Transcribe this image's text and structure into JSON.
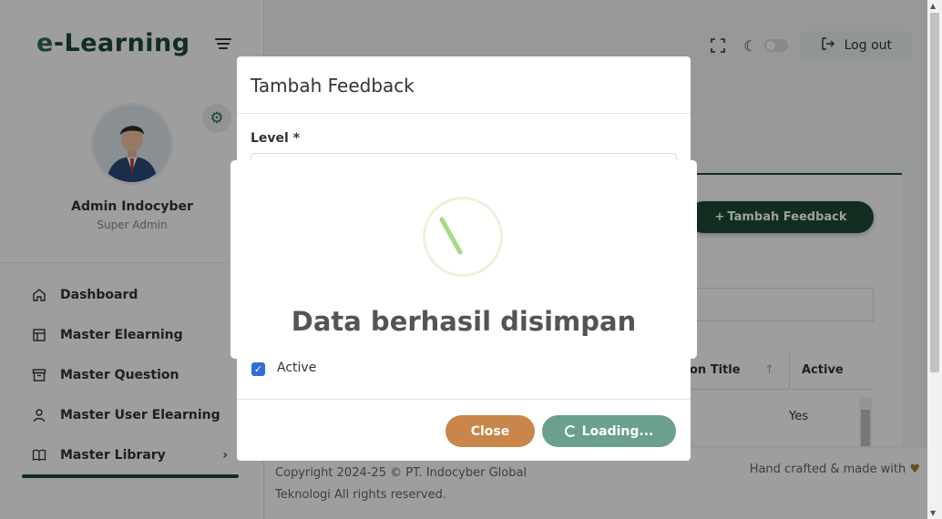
{
  "app": {
    "logo_text": "e-Learning",
    "logo_prefix": "e",
    "logo_rest": "-Learning"
  },
  "user": {
    "name": "Admin Indocyber",
    "role": "Super Admin"
  },
  "sidebar": {
    "items": [
      {
        "label": "Dashboard",
        "icon": "home-icon"
      },
      {
        "label": "Master Elearning",
        "icon": "layout-icon"
      },
      {
        "label": "Master Question",
        "icon": "archive-icon"
      },
      {
        "label": "Master User Elearning",
        "icon": "user-icon"
      },
      {
        "label": "Master Library",
        "icon": "book-icon",
        "chevron": "›"
      }
    ]
  },
  "topbar": {
    "logout_label": "Log out"
  },
  "content": {
    "add_button_label": "Tambah Feedback",
    "table": {
      "headers": [
        "on Title",
        "Active"
      ],
      "rows": [
        {
          "active": "Yes"
        }
      ]
    }
  },
  "footer": {
    "copyright": "Copyright 2024-25 © PT. Indocyber Global Teknologi All rights reserved.",
    "hand_crafted": "Hand crafted & made with"
  },
  "modal": {
    "title": "Tambah Feedback",
    "level_label": "Level *",
    "active_label": "Active",
    "active_checked": true,
    "close_label": "Close",
    "loading_label": "Loading..."
  },
  "alert": {
    "message": "Data berhasil disimpan"
  },
  "colors": {
    "brand_dark_green": "#1c4a35",
    "close_button": "#c8864a",
    "loading_button": "#6aa08c",
    "checkbox": "#2f6fd6"
  }
}
